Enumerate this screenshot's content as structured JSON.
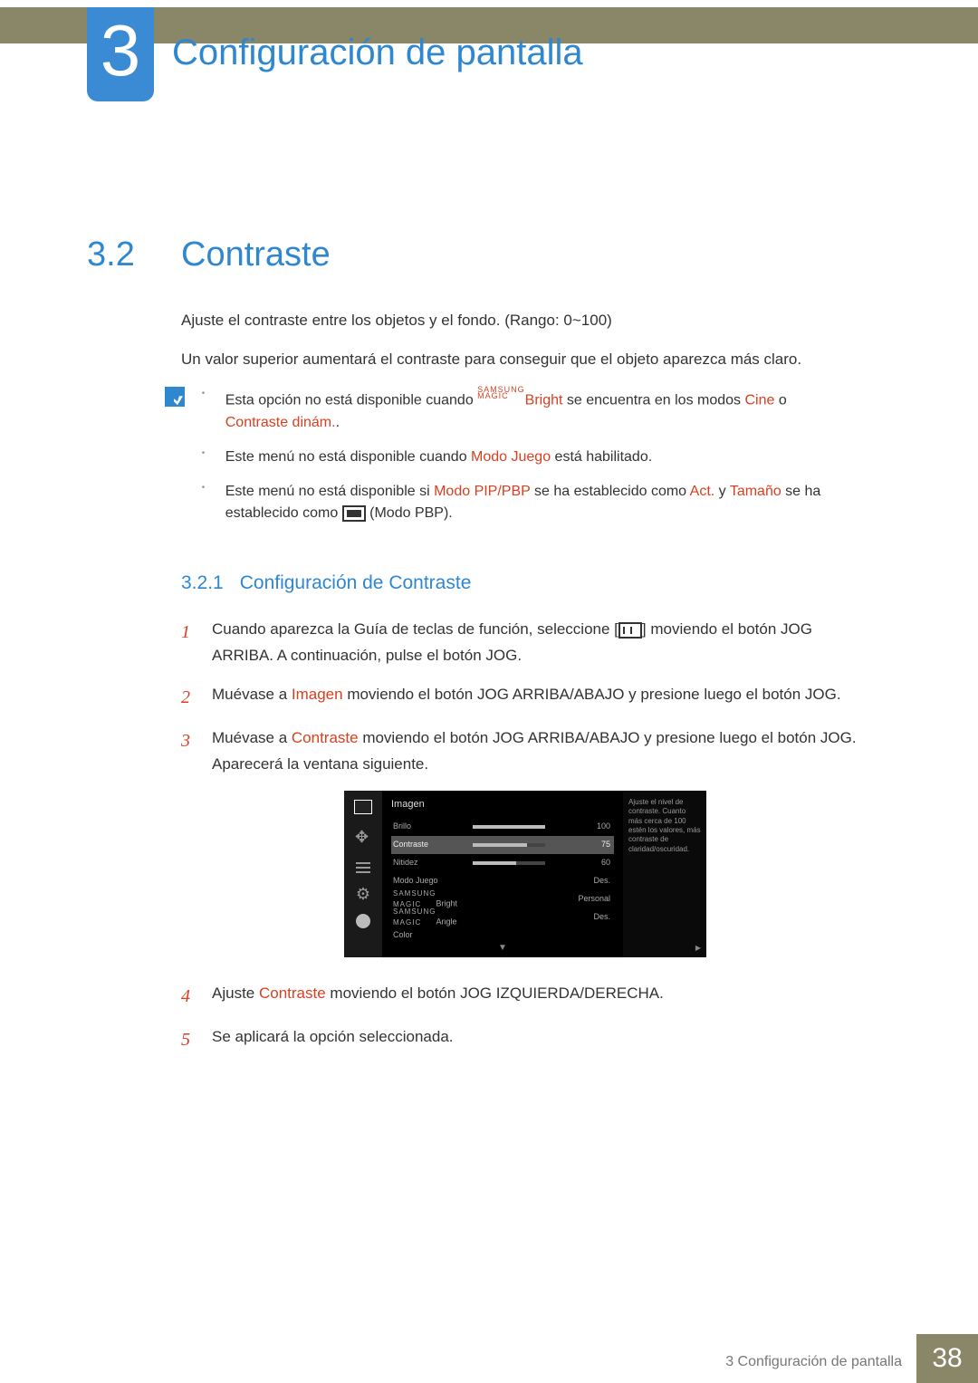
{
  "chapter": {
    "number": "3",
    "title": "Configuración de pantalla"
  },
  "section": {
    "number": "3.2",
    "title": "Contraste"
  },
  "intro": {
    "p1": "Ajuste el contraste entre los objetos y el fondo. (Rango: 0~100)",
    "p2": "Un valor superior aumentará el contraste para conseguir que el objeto aparezca más claro."
  },
  "notes": {
    "n1_a": "Esta opción no está disponible cuando ",
    "n1_magic_top": "SAMSUNG",
    "n1_magic_bot": "MAGIC",
    "n1_bright": "Bright",
    "n1_b": " se encuentra en los modos ",
    "n1_cine": "Cine",
    "n1_c": " o ",
    "n1_dyn": "Contraste dinám.",
    "n1_d": ".",
    "n2_a": "Este menú no está disponible cuando ",
    "n2_mode": "Modo Juego",
    "n2_b": " está habilitado.",
    "n3_a": "Este menú no está disponible si ",
    "n3_mode": "Modo PIP/PBP",
    "n3_b": " se ha establecido como ",
    "n3_act": "Act.",
    "n3_c": " y ",
    "n3_tam": "Tamaño",
    "n3_d": " se ha establecido como ",
    "n3_e": " (Modo PBP)."
  },
  "subsection": {
    "number": "3.2.1",
    "title": "Configuración de Contraste"
  },
  "steps": {
    "s1_a": "Cuando aparezca la Guía de teclas de función, seleccione [",
    "s1_b": "] moviendo el botón JOG ARRIBA. A continuación, pulse el botón JOG.",
    "s2_a": "Muévase a ",
    "s2_k": "Imagen",
    "s2_b": " moviendo el botón JOG ARRIBA/ABAJO y presione luego el botón JOG.",
    "s3_a": "Muévase a ",
    "s3_k": "Contraste",
    "s3_b": " moviendo el botón JOG ARRIBA/ABAJO y presione luego el botón JOG. Aparecerá la ventana siguiente.",
    "s4_a": "Ajuste ",
    "s4_k": "Contraste",
    "s4_b": " moviendo el botón JOG IZQUIERDA/DERECHA.",
    "s5": "Se aplicará la opción seleccionada."
  },
  "osd": {
    "title": "Imagen",
    "rows": [
      {
        "label": "Brillo",
        "value": "100",
        "bar": 100
      },
      {
        "label": "Contraste",
        "value": "75",
        "bar": 75,
        "active": true
      },
      {
        "label": "Nitidez",
        "value": "60",
        "bar": 60
      },
      {
        "label": "Modo Juego",
        "value": "Des."
      },
      {
        "label_top": "SAMSUNG",
        "label_bot": "MAGIC",
        "label_suffix": "Bright",
        "value": "Personal"
      },
      {
        "label_top": "SAMSUNG",
        "label_bot": "MAGIC",
        "label_suffix": "Angle",
        "value": "Des."
      },
      {
        "label": "Color",
        "value": ""
      }
    ],
    "help": "Ajuste el nivel de contraste. Cuanto más cerca de 100 estén los valores, más contraste de claridad/oscuridad."
  },
  "footer": {
    "text": "3 Configuración de pantalla",
    "page": "38"
  }
}
